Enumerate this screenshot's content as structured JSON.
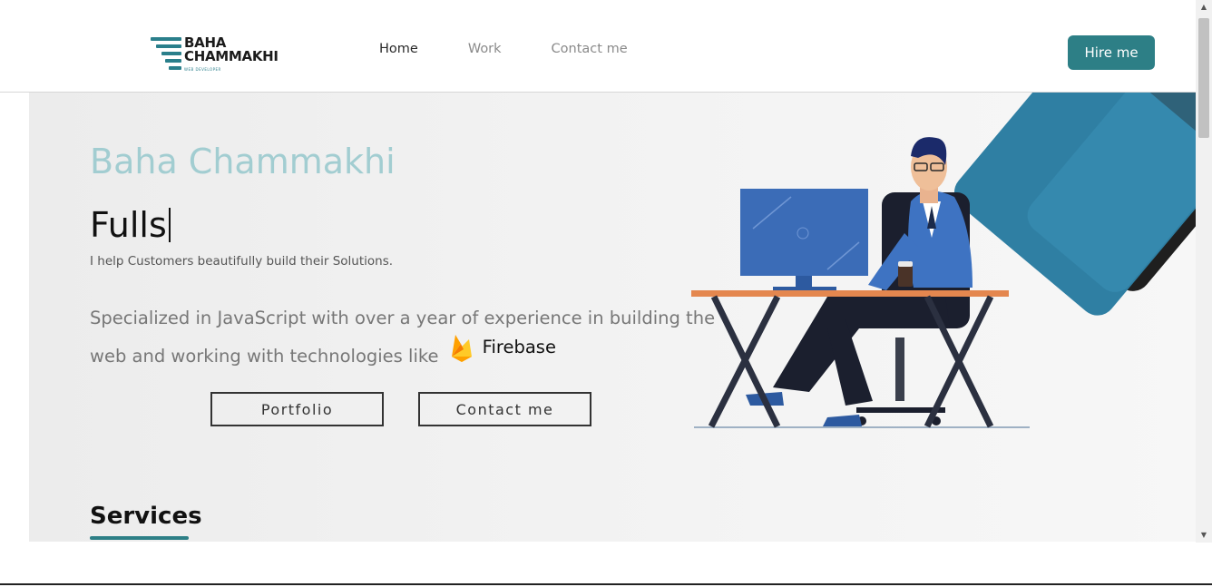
{
  "header": {
    "logo": {
      "line1": "BAHA",
      "line2": "CHAMMAKHI",
      "tag": "WEB DEVELOPER"
    },
    "nav": [
      {
        "label": "Home",
        "active": true
      },
      {
        "label": "Work",
        "active": false
      },
      {
        "label": "Contact me",
        "active": false
      }
    ],
    "hire_label": "Hire me"
  },
  "hero": {
    "name": "Baha Chammakhi",
    "typed_text": "Fulls",
    "tagline": "I help Customers beautifully build their Solutions.",
    "specialized_text": "Specialized in JavaScript with over a year of experience in building the web and working with technologies like",
    "technology": {
      "name": "Firebase",
      "icon": "firebase-icon"
    },
    "buttons": {
      "portfolio": "Portfolio",
      "contact": "Contact me"
    }
  },
  "services": {
    "title": "Services"
  },
  "colors": {
    "accent": "#2d7f86",
    "name": "#a2cdd1",
    "monitor": "#3b6cb7",
    "desk": "#e4874f"
  }
}
